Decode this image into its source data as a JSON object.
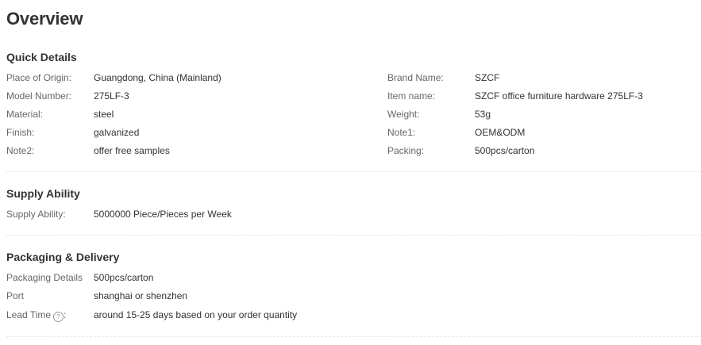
{
  "title": "Overview",
  "quick_details": {
    "heading": "Quick Details",
    "left": [
      {
        "label": "Place of Origin:",
        "value": "Guangdong, China (Mainland)"
      },
      {
        "label": "Model Number:",
        "value": "275LF-3"
      },
      {
        "label": "Material:",
        "value": "steel"
      },
      {
        "label": "Finish:",
        "value": "galvanized"
      },
      {
        "label": "Note2:",
        "value": "offer free samples"
      }
    ],
    "right": [
      {
        "label": "Brand Name:",
        "value": "SZCF"
      },
      {
        "label": "Item name:",
        "value": "SZCF office furniture hardware 275LF-3"
      },
      {
        "label": "Weight:",
        "value": "53g"
      },
      {
        "label": "Note1:",
        "value": "OEM&ODM"
      },
      {
        "label": "Packing:",
        "value": "500pcs/carton"
      }
    ]
  },
  "supply_ability": {
    "heading": "Supply Ability",
    "rows": [
      {
        "label": "Supply Ability:",
        "value": "5000000 Piece/Pieces per Week"
      }
    ]
  },
  "packaging_delivery": {
    "heading": "Packaging & Delivery",
    "rows": [
      {
        "label": "Packaging Details",
        "value": "500pcs/carton"
      },
      {
        "label": "Port",
        "value": "shanghai or shenzhen"
      },
      {
        "label": "Lead Time",
        "suffix": ":",
        "value": "around 15-25 days based on your order quantity",
        "icon": "help-icon"
      }
    ]
  }
}
